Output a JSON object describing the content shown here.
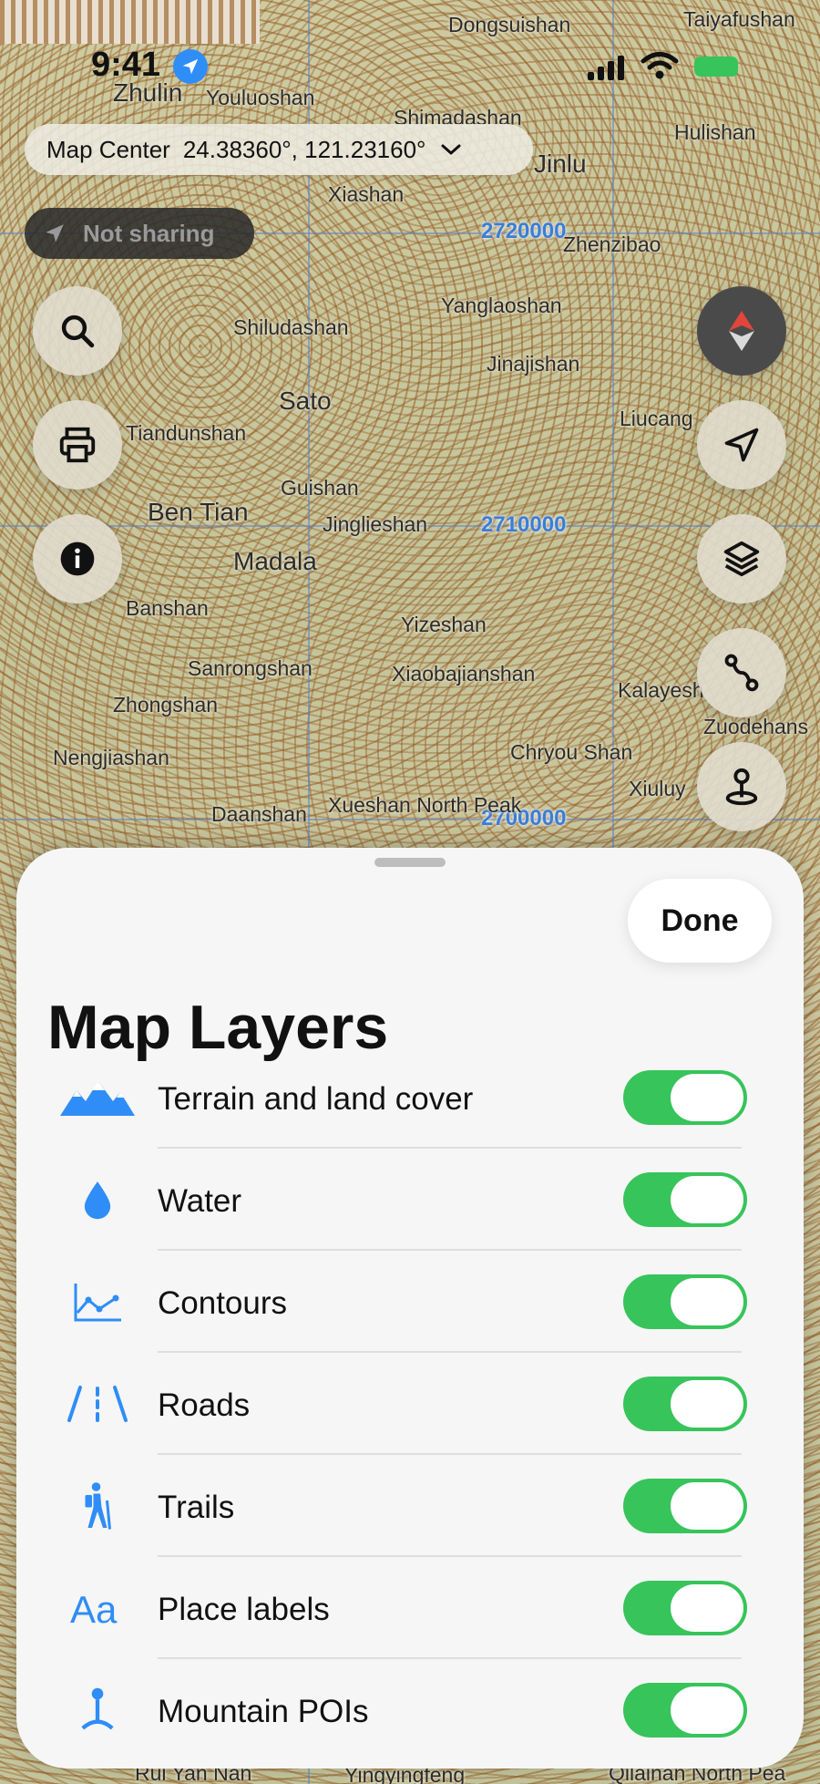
{
  "status_bar": {
    "time": "9:41"
  },
  "map": {
    "grid_labels": [
      "2720000",
      "2710000",
      "2700000"
    ],
    "places": [
      "Dongsuishan",
      "Taiyafushan",
      "Zhulin",
      "Youluoshan",
      "Shimadashan",
      "Jinlu",
      "Hulishan",
      "Xiashan",
      "Zhenzibao",
      "Yanglaoshan",
      "Shiludashan",
      "Jinajishan",
      "Sato",
      "Tiandunshan",
      "Liucang",
      "Guishan",
      "Ben Tian",
      "Jinglieshan",
      "Madala",
      "Banshan",
      "Yizeshan",
      "Sanrongshan",
      "Xiaobajianshan",
      "Zhongshan",
      "Kalayesh",
      "Zuodehans",
      "Chryou Shan",
      "Nengjiashan",
      "Xiuluy",
      "Daanshan",
      "Xueshan North Peak",
      "Rui Yan Nan",
      "Yingyingfeng",
      "Qilainan North Pea"
    ]
  },
  "map_center": {
    "label": "Map Center",
    "coords": "24.38360°, 121.23160°"
  },
  "sharing": {
    "label": "Not sharing"
  },
  "left_buttons": [
    "search-icon",
    "printer-icon",
    "info-icon"
  ],
  "right_buttons": [
    "compass-icon",
    "navigation-arrow-icon",
    "layers-icon",
    "route-icon",
    "pin-icon"
  ],
  "sheet": {
    "done_label": "Done",
    "title": "Map Layers",
    "accent": "#2f8df7",
    "toggle_on_color": "#37c45a",
    "layers": [
      {
        "label": "Terrain and land cover",
        "icon": "mountains-icon",
        "on": true
      },
      {
        "label": "Water",
        "icon": "water-drop-icon",
        "on": true
      },
      {
        "label": "Contours",
        "icon": "contours-icon",
        "on": true
      },
      {
        "label": "Roads",
        "icon": "road-icon",
        "on": true
      },
      {
        "label": "Trails",
        "icon": "hiker-icon",
        "on": true
      },
      {
        "label": "Place labels",
        "icon": "text-aa-icon",
        "on": true
      },
      {
        "label": "Mountain POIs",
        "icon": "mountain-poi-icon",
        "on": true
      }
    ]
  }
}
